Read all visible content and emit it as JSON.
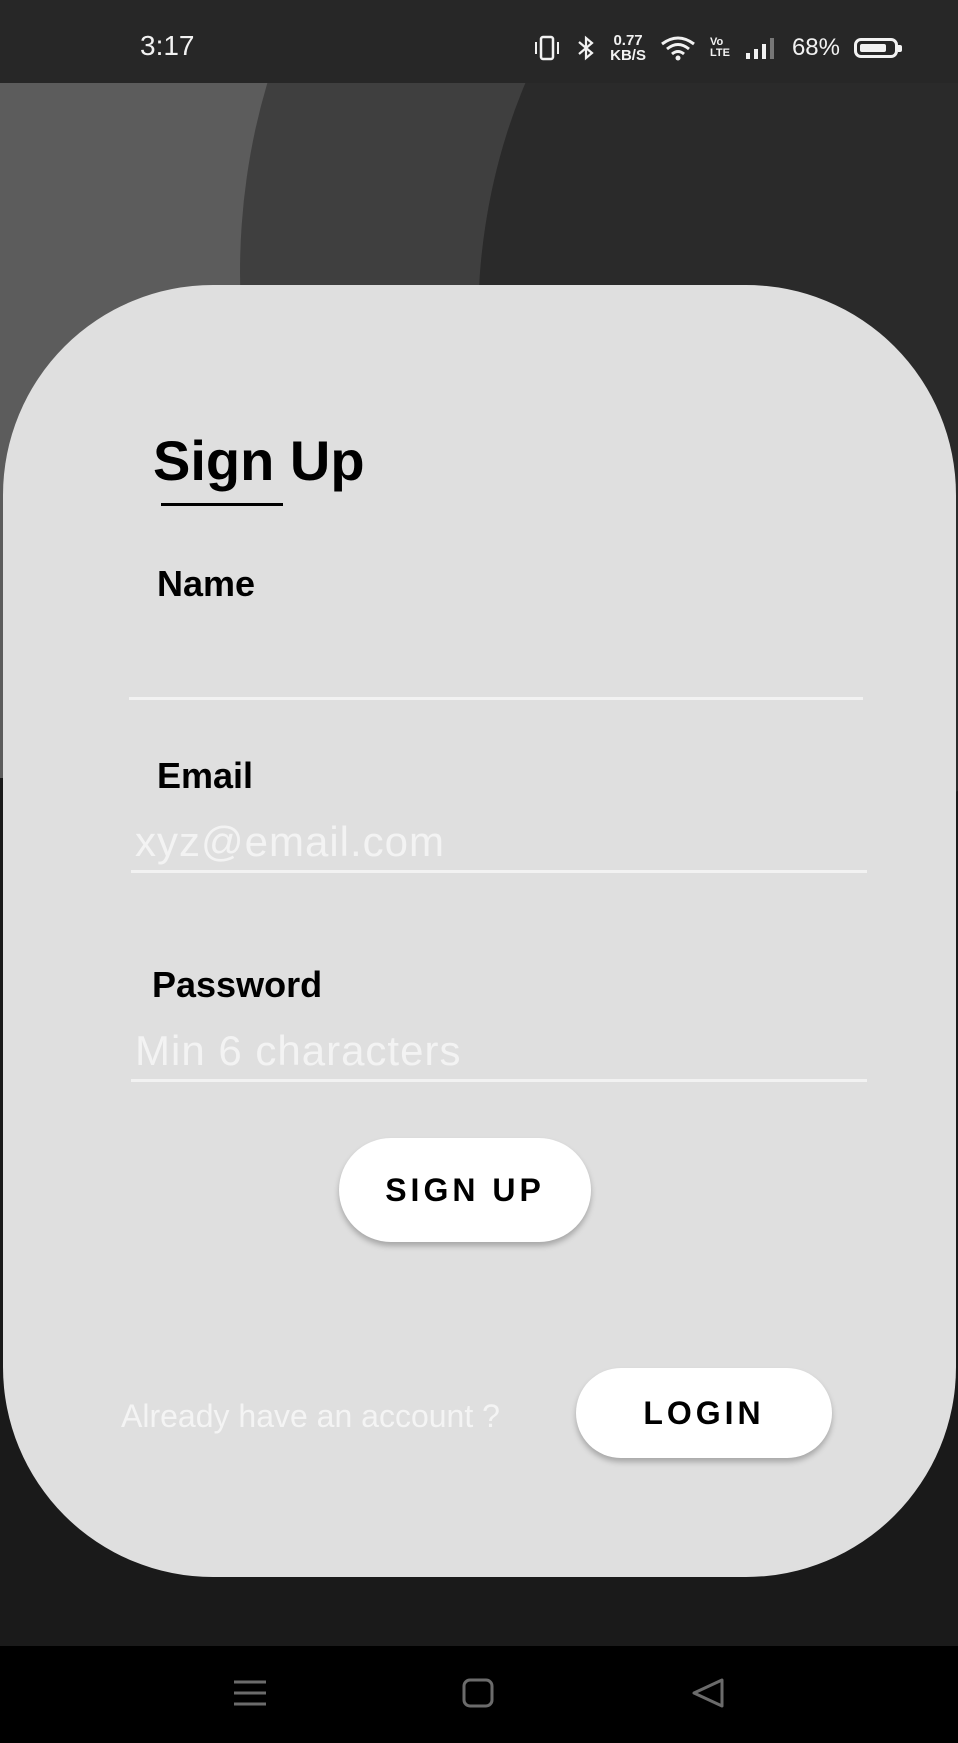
{
  "status_bar": {
    "time": "3:17",
    "speed_value": "0.77",
    "speed_unit": "KB/S",
    "volte_top": "Vo",
    "volte_bottom": "LTE",
    "battery_percent": "68%"
  },
  "form": {
    "title": "Sign Up",
    "name_label": "Name",
    "name_value": "",
    "email_label": "Email",
    "email_placeholder": "xyz@email.com",
    "password_label": "Password",
    "password_placeholder": "Min 6 characters",
    "signup_button": "SIGN UP",
    "login_prompt": "Already have an account ?",
    "login_button": "LOGIN"
  },
  "colors": {
    "card": "#dfdfdf",
    "button": "#ffffff",
    "background": "#1a1a1a"
  },
  "nav_icons": [
    "menu-icon",
    "home-icon",
    "back-icon"
  ]
}
